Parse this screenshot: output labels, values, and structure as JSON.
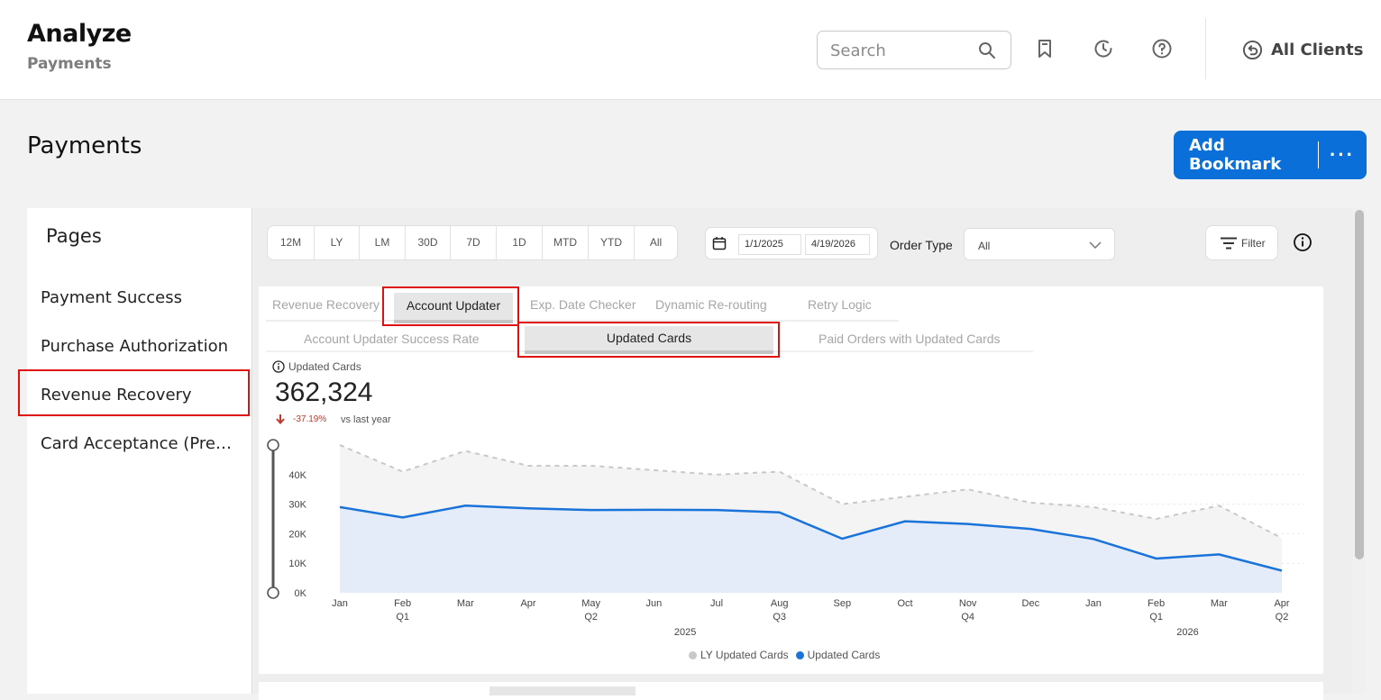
{
  "header": {
    "title": "Analyze",
    "subtitle": "Payments",
    "search_placeholder": "Search",
    "icons": [
      "search-icon",
      "bookmark-icon",
      "history-icon",
      "help-icon",
      "undo-icon"
    ],
    "all_clients_label": "All Clients"
  },
  "page": {
    "heading": "Payments",
    "add_bookmark_label": "Add Bookmark",
    "more_label": "···",
    "accent_color": "#0a6fd9",
    "highlight_color": "#e01010"
  },
  "sidebar": {
    "title": "Pages",
    "items": [
      {
        "label": "Payment Success"
      },
      {
        "label": "Purchase Authorization"
      },
      {
        "label": "Revenue Recovery"
      },
      {
        "label": "Card Acceptance (Preview)"
      }
    ],
    "selected": "Revenue Recovery"
  },
  "filters": {
    "periods": [
      "12M",
      "LY",
      "LM",
      "30D",
      "7D",
      "1D",
      "MTD",
      "YTD",
      "All"
    ],
    "date_from": "1/1/2025",
    "date_to": "4/19/2026",
    "order_type_label": "Order Type",
    "order_type_value": "All",
    "filter_label": "Filter"
  },
  "tabs": {
    "primary": [
      "Revenue Recovery",
      "Account Updater",
      "Exp. Date Checker",
      "Dynamic Re-routing",
      "Retry Logic"
    ],
    "primary_active": "Account Updater",
    "secondary": [
      "Account Updater Success Rate",
      "Updated Cards",
      "Paid Orders with Updated Cards"
    ],
    "secondary_active": "Updated Cards"
  },
  "kpi": {
    "title": "Updated Cards",
    "value": "362,324",
    "delta": "-37.19%",
    "comparison": "vs last year"
  },
  "chart_data": {
    "type": "area",
    "categories": [
      "Jan",
      "Feb",
      "Mar",
      "Apr",
      "May",
      "Jun",
      "Jul",
      "Aug",
      "Sep",
      "Oct",
      "Nov",
      "Dec",
      "Jan",
      "Feb",
      "Mar",
      "Apr"
    ],
    "quarter_labels": [
      "",
      "Q1",
      "",
      "",
      "Q2",
      "",
      "",
      "Q3",
      "",
      "",
      "Q4",
      "",
      "",
      "Q1",
      "",
      "Q2"
    ],
    "year_labels": [
      {
        "label": "2025",
        "at_index": 5.5
      },
      {
        "label": "2026",
        "at_index": 13.5
      }
    ],
    "series": [
      {
        "name": "LY Updated Cards",
        "color": "#c8c8c8",
        "style": "dashed",
        "values": [
          50000,
          41000,
          48000,
          43000,
          43000,
          41500,
          40000,
          41000,
          30000,
          32500,
          35000,
          30500,
          29000,
          25000,
          29500,
          18500
        ]
      },
      {
        "name": "Updated Cards",
        "color": "#1a73d8",
        "style": "solid",
        "values": [
          29000,
          25500,
          29500,
          28600,
          28000,
          28100,
          28000,
          27200,
          18300,
          24200,
          23300,
          21600,
          18200,
          11600,
          13000,
          7500
        ]
      }
    ],
    "yticks": [
      "0K",
      "10K",
      "20K",
      "30K",
      "40K"
    ],
    "ylim": [
      0,
      50000
    ],
    "grid": true,
    "legend_position": "bottom"
  }
}
